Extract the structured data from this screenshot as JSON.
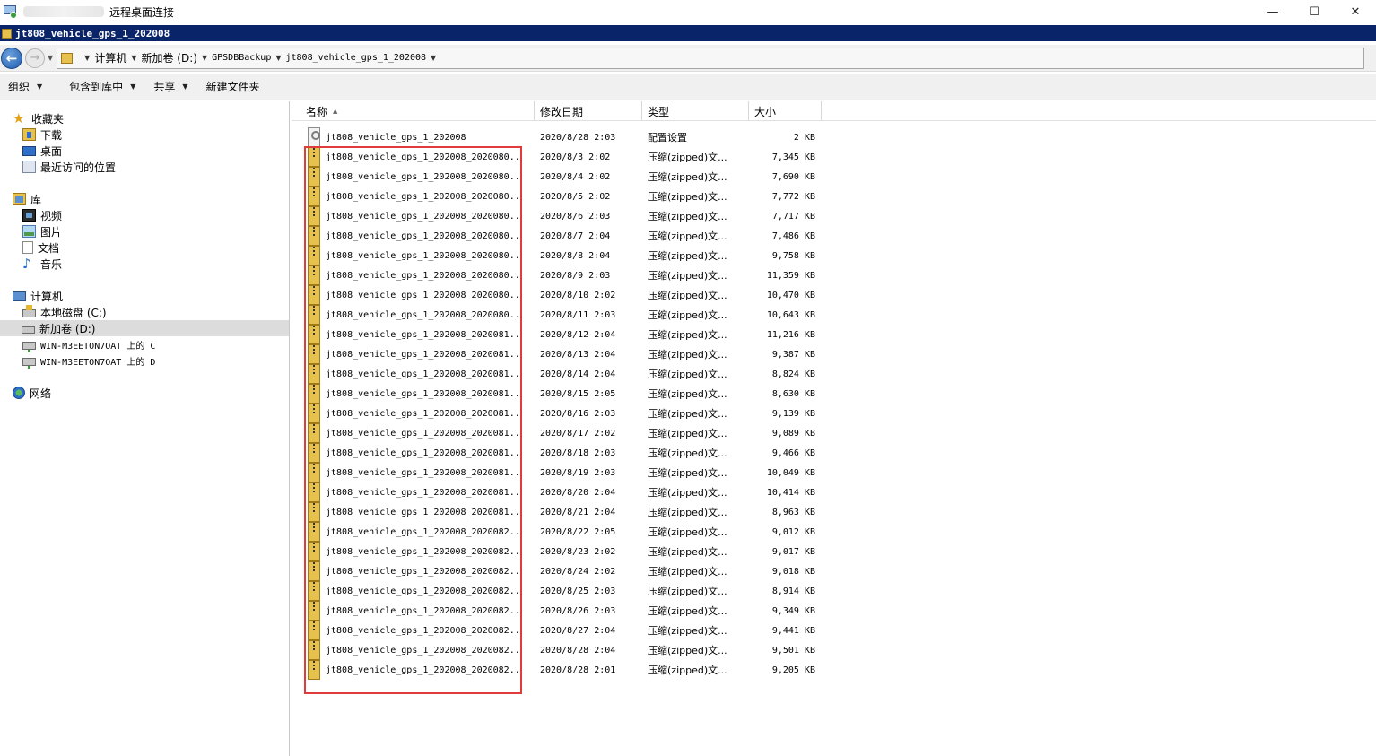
{
  "rdp": {
    "title": "远程桌面连接",
    "min": "—",
    "max": "☐",
    "close": "✕"
  },
  "explorer": {
    "title": "jt808_vehicle_gps_1_202008"
  },
  "address": {
    "crumbs": [
      "计算机",
      "新加卷 (D:)",
      "GPSDBBackup",
      "jt808_vehicle_gps_1_202008"
    ]
  },
  "toolbar": {
    "organize": "组织",
    "include": "包含到库中",
    "share": "共享",
    "new_folder": "新建文件夹"
  },
  "nav": {
    "favorites": "收藏夹",
    "downloads": "下载",
    "desktop": "桌面",
    "recent": "最近访问的位置",
    "libraries": "库",
    "videos": "视频",
    "pictures": "图片",
    "documents": "文档",
    "music": "音乐",
    "computer": "计算机",
    "local_c": "本地磁盘 (C:)",
    "vol_d": "新加卷 (D:)",
    "net_c": "WIN-M3EETON7OAT 上的 C",
    "net_d": "WIN-M3EETON7OAT 上的 D",
    "network": "网络"
  },
  "columns": {
    "name": "名称",
    "date": "修改日期",
    "type": "类型",
    "size": "大小"
  },
  "files": [
    {
      "name": "jt808_vehicle_gps_1_202008",
      "date": "2020/8/28 2:03",
      "type": "配置设置",
      "size": "2 KB",
      "icon": "config-file-icon"
    },
    {
      "name": "jt808_vehicle_gps_1_202008_2020080...",
      "date": "2020/8/3 2:02",
      "type": "压缩(zipped)文...",
      "size": "7,345 KB",
      "icon": "zip-folder-icon"
    },
    {
      "name": "jt808_vehicle_gps_1_202008_2020080...",
      "date": "2020/8/4 2:02",
      "type": "压缩(zipped)文...",
      "size": "7,690 KB",
      "icon": "zip-folder-icon"
    },
    {
      "name": "jt808_vehicle_gps_1_202008_2020080...",
      "date": "2020/8/5 2:02",
      "type": "压缩(zipped)文...",
      "size": "7,772 KB",
      "icon": "zip-folder-icon"
    },
    {
      "name": "jt808_vehicle_gps_1_202008_2020080...",
      "date": "2020/8/6 2:03",
      "type": "压缩(zipped)文...",
      "size": "7,717 KB",
      "icon": "zip-folder-icon"
    },
    {
      "name": "jt808_vehicle_gps_1_202008_2020080...",
      "date": "2020/8/7 2:04",
      "type": "压缩(zipped)文...",
      "size": "7,486 KB",
      "icon": "zip-folder-icon"
    },
    {
      "name": "jt808_vehicle_gps_1_202008_2020080...",
      "date": "2020/8/8 2:04",
      "type": "压缩(zipped)文...",
      "size": "9,758 KB",
      "icon": "zip-folder-icon"
    },
    {
      "name": "jt808_vehicle_gps_1_202008_2020080...",
      "date": "2020/8/9 2:03",
      "type": "压缩(zipped)文...",
      "size": "11,359 KB",
      "icon": "zip-folder-icon"
    },
    {
      "name": "jt808_vehicle_gps_1_202008_2020080...",
      "date": "2020/8/10 2:02",
      "type": "压缩(zipped)文...",
      "size": "10,470 KB",
      "icon": "zip-folder-icon"
    },
    {
      "name": "jt808_vehicle_gps_1_202008_2020080...",
      "date": "2020/8/11 2:03",
      "type": "压缩(zipped)文...",
      "size": "10,643 KB",
      "icon": "zip-folder-icon"
    },
    {
      "name": "jt808_vehicle_gps_1_202008_2020081...",
      "date": "2020/8/12 2:04",
      "type": "压缩(zipped)文...",
      "size": "11,216 KB",
      "icon": "zip-folder-icon"
    },
    {
      "name": "jt808_vehicle_gps_1_202008_2020081...",
      "date": "2020/8/13 2:04",
      "type": "压缩(zipped)文...",
      "size": "9,387 KB",
      "icon": "zip-folder-icon"
    },
    {
      "name": "jt808_vehicle_gps_1_202008_2020081...",
      "date": "2020/8/14 2:04",
      "type": "压缩(zipped)文...",
      "size": "8,824 KB",
      "icon": "zip-folder-icon"
    },
    {
      "name": "jt808_vehicle_gps_1_202008_2020081...",
      "date": "2020/8/15 2:05",
      "type": "压缩(zipped)文...",
      "size": "8,630 KB",
      "icon": "zip-folder-icon"
    },
    {
      "name": "jt808_vehicle_gps_1_202008_2020081...",
      "date": "2020/8/16 2:03",
      "type": "压缩(zipped)文...",
      "size": "9,139 KB",
      "icon": "zip-folder-icon"
    },
    {
      "name": "jt808_vehicle_gps_1_202008_2020081...",
      "date": "2020/8/17 2:02",
      "type": "压缩(zipped)文...",
      "size": "9,089 KB",
      "icon": "zip-folder-icon"
    },
    {
      "name": "jt808_vehicle_gps_1_202008_2020081...",
      "date": "2020/8/18 2:03",
      "type": "压缩(zipped)文...",
      "size": "9,466 KB",
      "icon": "zip-folder-icon"
    },
    {
      "name": "jt808_vehicle_gps_1_202008_2020081...",
      "date": "2020/8/19 2:03",
      "type": "压缩(zipped)文...",
      "size": "10,049 KB",
      "icon": "zip-folder-icon"
    },
    {
      "name": "jt808_vehicle_gps_1_202008_2020081...",
      "date": "2020/8/20 2:04",
      "type": "压缩(zipped)文...",
      "size": "10,414 KB",
      "icon": "zip-folder-icon"
    },
    {
      "name": "jt808_vehicle_gps_1_202008_2020081...",
      "date": "2020/8/21 2:04",
      "type": "压缩(zipped)文...",
      "size": "8,963 KB",
      "icon": "zip-folder-icon"
    },
    {
      "name": "jt808_vehicle_gps_1_202008_2020082...",
      "date": "2020/8/22 2:05",
      "type": "压缩(zipped)文...",
      "size": "9,012 KB",
      "icon": "zip-folder-icon"
    },
    {
      "name": "jt808_vehicle_gps_1_202008_2020082...",
      "date": "2020/8/23 2:02",
      "type": "压缩(zipped)文...",
      "size": "9,017 KB",
      "icon": "zip-folder-icon"
    },
    {
      "name": "jt808_vehicle_gps_1_202008_2020082...",
      "date": "2020/8/24 2:02",
      "type": "压缩(zipped)文...",
      "size": "9,018 KB",
      "icon": "zip-folder-icon"
    },
    {
      "name": "jt808_vehicle_gps_1_202008_2020082...",
      "date": "2020/8/25 2:03",
      "type": "压缩(zipped)文...",
      "size": "8,914 KB",
      "icon": "zip-folder-icon"
    },
    {
      "name": "jt808_vehicle_gps_1_202008_2020082...",
      "date": "2020/8/26 2:03",
      "type": "压缩(zipped)文...",
      "size": "9,349 KB",
      "icon": "zip-folder-icon"
    },
    {
      "name": "jt808_vehicle_gps_1_202008_2020082...",
      "date": "2020/8/27 2:04",
      "type": "压缩(zipped)文...",
      "size": "9,441 KB",
      "icon": "zip-folder-icon"
    },
    {
      "name": "jt808_vehicle_gps_1_202008_2020082...",
      "date": "2020/8/28 2:04",
      "type": "压缩(zipped)文...",
      "size": "9,501 KB",
      "icon": "zip-folder-icon"
    },
    {
      "name": "jt808_vehicle_gps_1_202008_2020082...",
      "date": "2020/8/28 2:01",
      "type": "压缩(zipped)文...",
      "size": "9,205 KB",
      "icon": "zip-folder-icon"
    }
  ],
  "colors": {
    "title_bar": "#0a246a",
    "highlight_box": "#e03a3a",
    "selection": "#dcdcdc"
  }
}
